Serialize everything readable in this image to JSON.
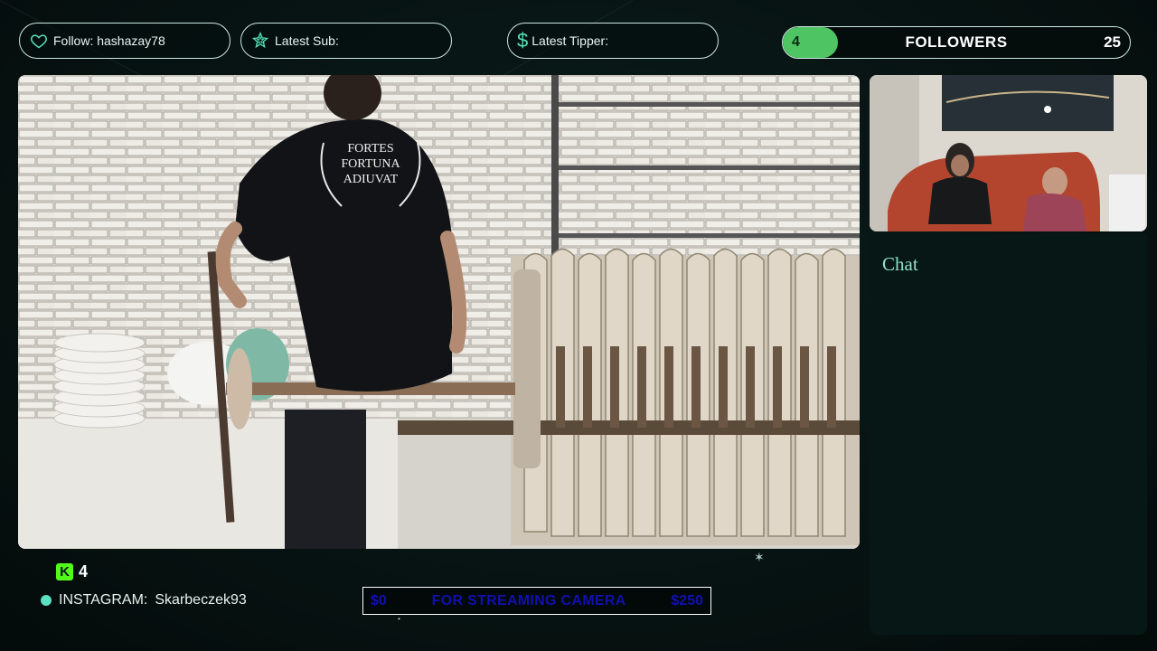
{
  "header": {
    "follow_label": "Follow: hashazay78",
    "latest_sub_label": "Latest Sub:",
    "latest_tipper_label": "Latest Tipper:",
    "tipper_currency_symbol": "$",
    "followers_goal": {
      "current": "4",
      "label": "FOLLOWERS",
      "goal": "25",
      "progress_fraction": 0.16,
      "fill_color": "#4ec463"
    }
  },
  "video": {
    "shirt_text": [
      "FORTES",
      "FORTUNA",
      "ADIUVAT"
    ]
  },
  "chat": {
    "title": "Chat"
  },
  "footer": {
    "kick_viewers": "4",
    "instagram_label": "INSTAGRAM:",
    "instagram_handle": "Skarbeczek93",
    "donation_goal": {
      "start": "$0",
      "text": "FOR STREAMING CAMERA",
      "end": "$250"
    }
  },
  "colors": {
    "accent": "#56e0b8",
    "kick_green": "#53fc18",
    "background": "#061110"
  }
}
